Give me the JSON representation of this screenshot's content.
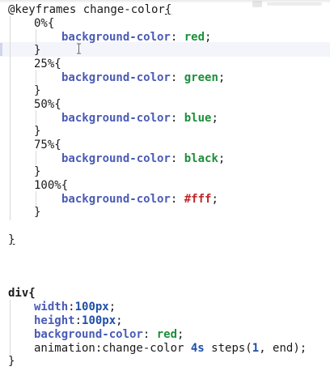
{
  "code": {
    "keyframes_line": "@keyframes change-color",
    "open_brace": "{",
    "close_brace": "}",
    "frames": [
      {
        "selector": "0%{",
        "prop": "background-color",
        "colon": ":",
        "value": "red",
        "semicolon": ";"
      },
      {
        "selector": "25%{",
        "prop": "background-color",
        "colon": ":",
        "value": "green",
        "semicolon": ";"
      },
      {
        "selector": "50%{",
        "prop": "background-color",
        "colon": ":",
        "value": "blue",
        "semicolon": ";"
      },
      {
        "selector": "75%{",
        "prop": "background-color",
        "colon": ":",
        "value": "black",
        "semicolon": ";"
      },
      {
        "selector": "100%{",
        "prop": "background-color",
        "colon": ":",
        "value": "#fff",
        "semicolon": ";"
      }
    ],
    "div_selector": "div{",
    "width_prop": "width",
    "width_value": "100px",
    "height_prop": "height",
    "height_value": "100px",
    "bg_prop": "background-color",
    "bg_value": "red",
    "animation_prefix": "animation:change-color ",
    "animation_duration": "4s",
    "animation_steps_open": " steps(",
    "animation_steps_num": "1",
    "animation_steps_close": ", end);"
  },
  "colors": {
    "property": "#4a5bb5",
    "value_keyword": "#1c8f3a",
    "hex_value": "#c0282b",
    "number": "#1f4fa8"
  }
}
